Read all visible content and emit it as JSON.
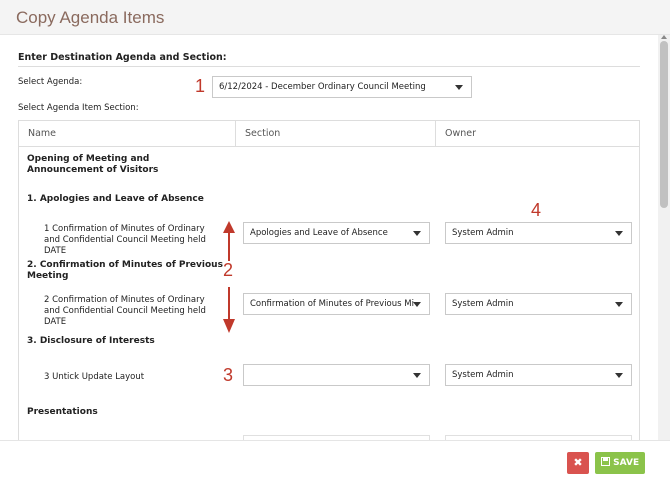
{
  "dialog": {
    "title": "Copy Agenda Items",
    "section_title": "Enter Destination Agenda and Section:",
    "select_agenda_label": "Select Agenda:",
    "select_agenda_value": "6/12/2024 - December Ordinary Council Meeting",
    "select_section_label": "Select Agenda Item Section:"
  },
  "table": {
    "columns": [
      "Name",
      "Section",
      "Owner"
    ],
    "groups": [
      "Opening of Meeting and Announcement of Visitors",
      "1. Apologies and Leave of Absence",
      "2. Confirmation of Minutes of Previous Meeting",
      "3. Disclosure of Interests",
      "Presentations"
    ],
    "items": [
      {
        "name": "1 Confirmation of Minutes of Ordinary and Confidential Council Meeting held DATE",
        "section": "Apologies and Leave of Absence",
        "owner": "System Admin"
      },
      {
        "name": "2 Confirmation of Minutes of Ordinary and Confidential Council Meeting held DATE",
        "section": "Confirmation of Minutes of Previous Mi",
        "owner": "System Admin"
      },
      {
        "name": "3 Untick Update Layout",
        "section": "",
        "owner": "System Admin"
      }
    ]
  },
  "annotations": [
    "1",
    "2",
    "3",
    "4"
  ],
  "footer": {
    "close_symbol": "✖",
    "save_label": "SAVE",
    "save_icon": "floppy-disk-icon"
  },
  "colors": {
    "title": "#8a6a5e",
    "annotation": "#c0392b",
    "save": "#8bc34a",
    "close": "#d9534f"
  }
}
